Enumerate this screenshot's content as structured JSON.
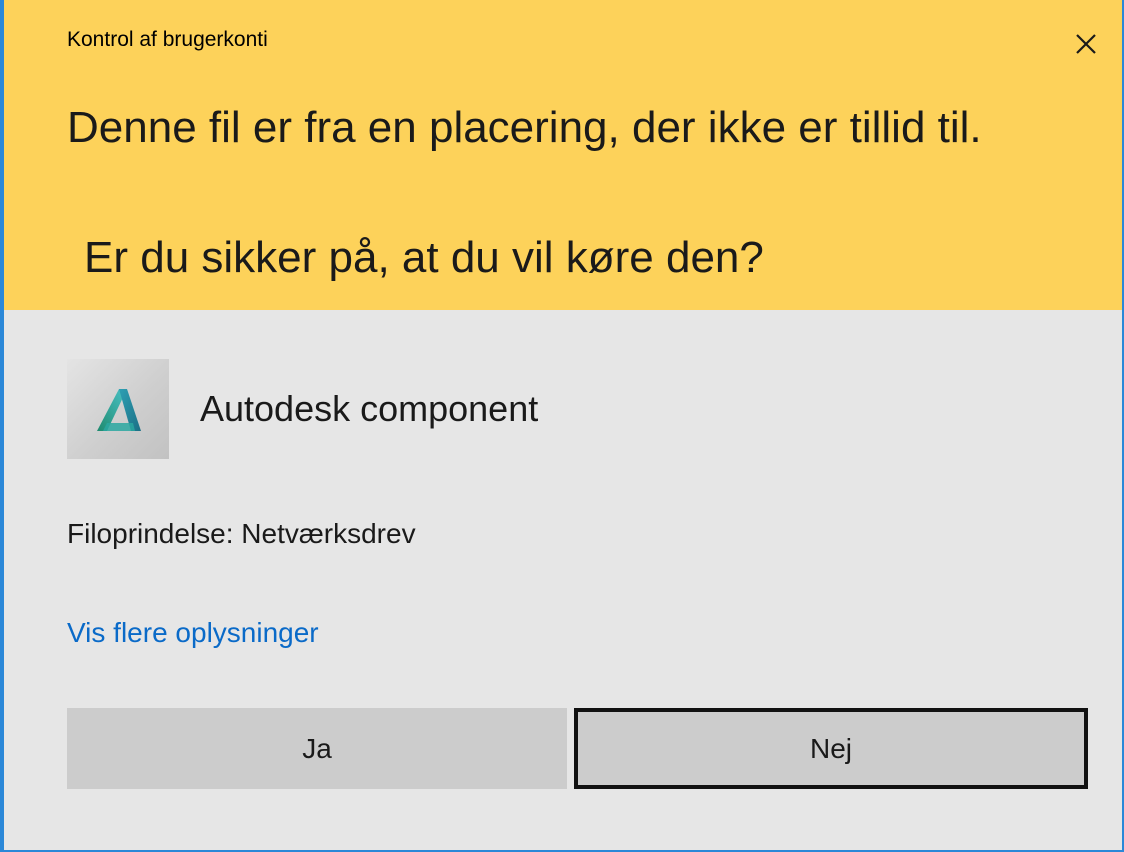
{
  "dialog": {
    "title": "Kontrol af brugerkonti",
    "close_icon": "close-icon",
    "headline": "Denne fil er fra en placering, der ikke er tillid til.",
    "question": "Er du sikker på, at du vil køre den?",
    "header_color": "#fdd25a",
    "body_color": "#e6e6e6",
    "accent_color": "#2b88d8"
  },
  "program": {
    "icon": "autodesk-logo-icon",
    "name": "Autodesk component"
  },
  "details": {
    "origin": "Filoprindelse: Netværksdrev",
    "more_info_link": "Vis flere oplysninger",
    "link_color": "#0a6ac8"
  },
  "buttons": {
    "yes_label": "Ja",
    "no_label": "Nej"
  }
}
